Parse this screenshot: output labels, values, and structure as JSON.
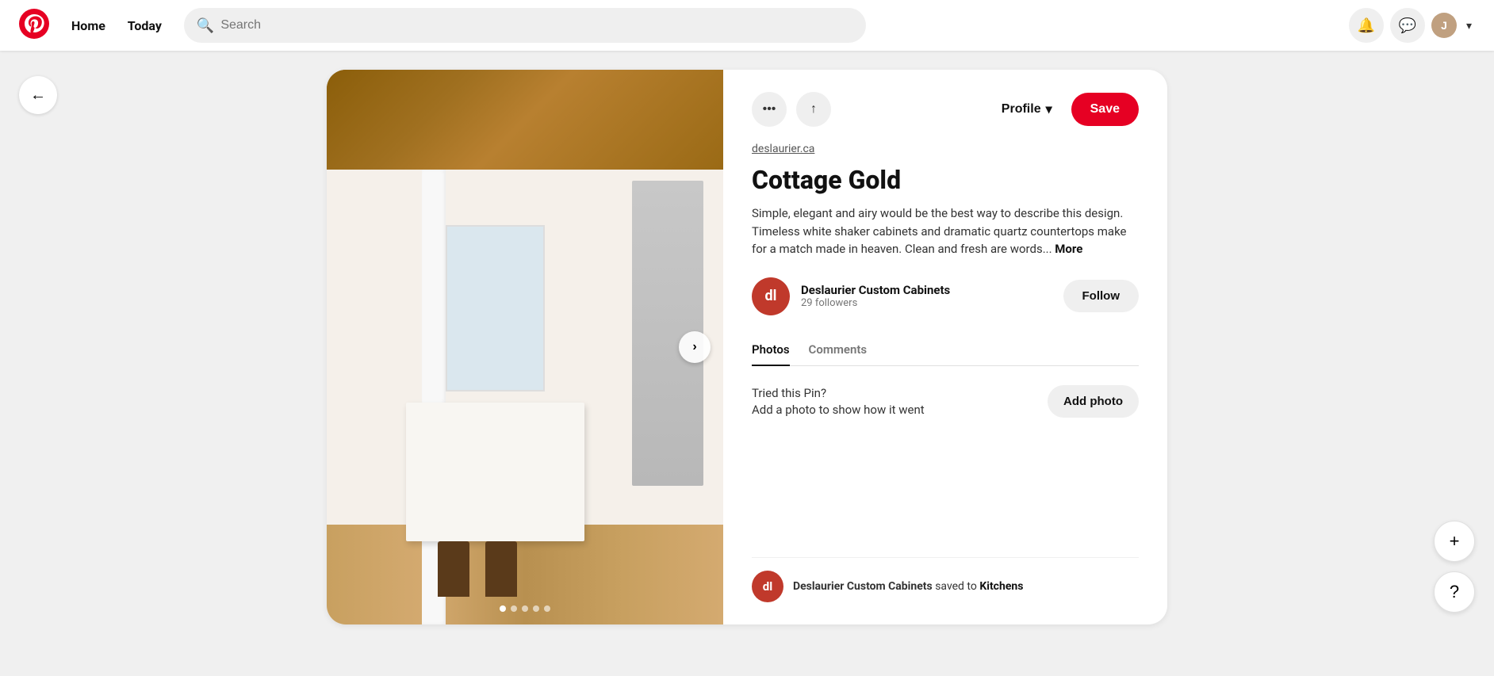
{
  "header": {
    "logo_alt": "Pinterest",
    "nav": {
      "home_label": "Home",
      "today_label": "Today"
    },
    "search": {
      "placeholder": "Search"
    },
    "icons": {
      "notification": "🔔",
      "messages": "💬"
    },
    "user_initial": "J"
  },
  "toolbar": {
    "more_icon": "•••",
    "share_icon": "↑",
    "profile_label": "Profile",
    "chevron_icon": "▾",
    "save_label": "Save"
  },
  "pin": {
    "source_link": "deslaurier.ca",
    "title": "Cottage Gold",
    "description": "Simple, elegant and airy would be the best way to describe this design. Timeless white shaker cabinets and dramatic quartz countertops make for a match made in heaven. Clean and fresh are words...",
    "more_label": "More",
    "author": {
      "name": "Deslaurier Custom Cabinets",
      "followers": "29 followers",
      "avatar_initials": "dl"
    },
    "follow_label": "Follow",
    "tabs": {
      "photos_label": "Photos",
      "comments_label": "Comments"
    },
    "try_pin": {
      "title": "Tried this Pin?",
      "subtitle": "Add a photo to show how it went",
      "button_label": "Add photo"
    },
    "saved_by": {
      "avatar_initials": "dl",
      "name": "Deslaurier Custom Cabinets",
      "saved_to_label": "saved to",
      "board_name": "Kitchens"
    },
    "carousel": {
      "next_icon": "›",
      "dots": [
        true,
        false,
        false,
        false,
        false
      ]
    }
  },
  "floating": {
    "add_icon": "+",
    "help_icon": "?"
  },
  "back": {
    "icon": "←"
  }
}
